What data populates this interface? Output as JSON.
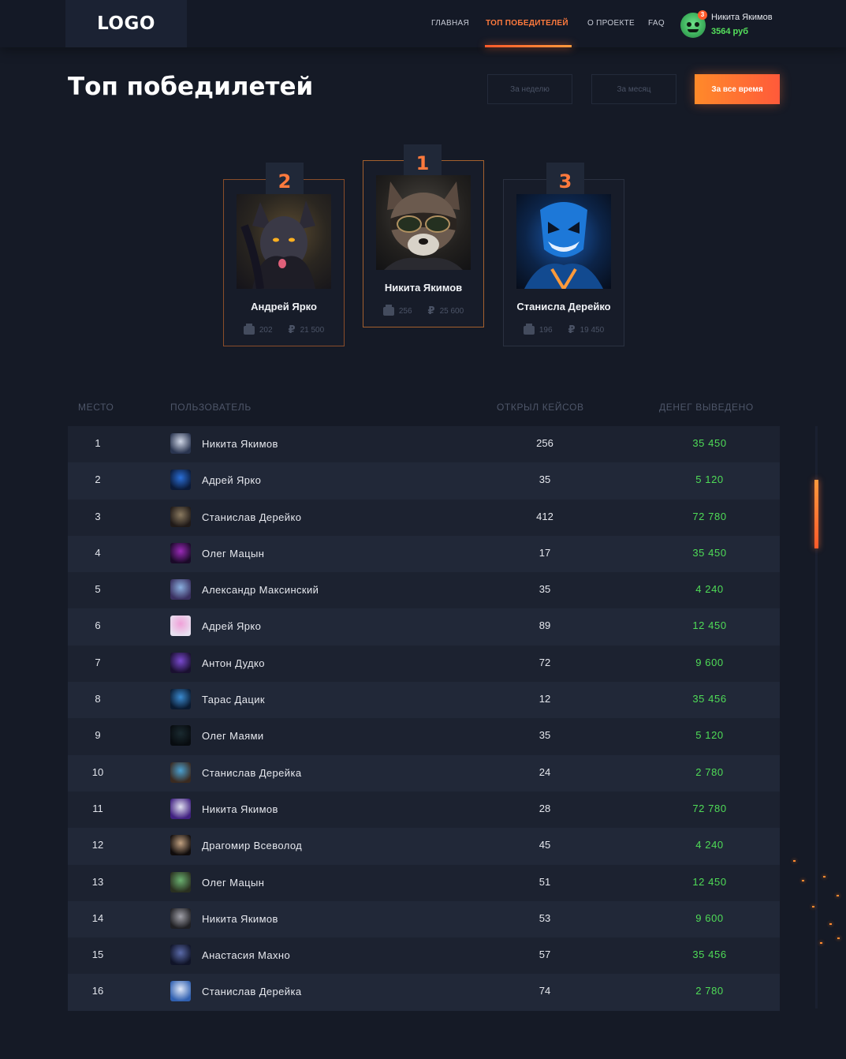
{
  "header": {
    "logo": "LOGO",
    "nav": [
      "ГЛАВНАЯ",
      "ТОП ПОБЕДИТЕЛЕЙ",
      "О ПРОЕКТЕ",
      "FAQ"
    ],
    "active_nav": "ТОП ПОБЕДИТЕЛЕЙ",
    "user": {
      "name": "Никита Якимов",
      "balance": "3564 руб",
      "notifications": "3"
    }
  },
  "page": {
    "title": "Топ победилетей",
    "filters": [
      "За неделю",
      "За месяц",
      "За все время"
    ],
    "active_filter": "За все время"
  },
  "podium": [
    {
      "rank": "2",
      "name": "Андрей Ярко",
      "cases": "202",
      "money": "21 500"
    },
    {
      "rank": "1",
      "name": "Никита Якимов",
      "cases": "256",
      "money": "25 600"
    },
    {
      "rank": "3",
      "name": "Станисла Дерейко",
      "cases": "196",
      "money": "19 450"
    }
  ],
  "table": {
    "headers": [
      "МЕСТО",
      "ПОЛЬЗОВАТЕЛЬ",
      "ОТКРЫЛ КЕЙСОВ",
      "ДЕНЕГ ВЫВЕДЕНО"
    ],
    "rows": [
      {
        "place": "1",
        "name": "Никита Якимов",
        "cases": "256",
        "money": "35 450"
      },
      {
        "place": "2",
        "name": "Адрей Ярко",
        "cases": "35",
        "money": "5 120"
      },
      {
        "place": "3",
        "name": "Станислав Дерейко",
        "cases": "412",
        "money": "72 780"
      },
      {
        "place": "4",
        "name": "Олег Мацын",
        "cases": "17",
        "money": "35 450"
      },
      {
        "place": "5",
        "name": "Александр Максинский",
        "cases": "35",
        "money": "4 240"
      },
      {
        "place": "6",
        "name": "Адрей Ярко",
        "cases": "89",
        "money": "12 450"
      },
      {
        "place": "7",
        "name": "Антон Дудко",
        "cases": "72",
        "money": "9 600"
      },
      {
        "place": "8",
        "name": "Тарас Дацик",
        "cases": "12",
        "money": "35 456"
      },
      {
        "place": "9",
        "name": "Олег Маями",
        "cases": "35",
        "money": "5 120"
      },
      {
        "place": "10",
        "name": "Станислав Дерейка",
        "cases": "24",
        "money": "2 780"
      },
      {
        "place": "11",
        "name": "Никита Якимов",
        "cases": "28",
        "money": "72 780"
      },
      {
        "place": "12",
        "name": "Драгомир Всеволод",
        "cases": "45",
        "money": "4 240"
      },
      {
        "place": "13",
        "name": "Олег Мацын",
        "cases": "51",
        "money": "12 450"
      },
      {
        "place": "14",
        "name": "Никита Якимов",
        "cases": "53",
        "money": "9 600"
      },
      {
        "place": "15",
        "name": "Анастасия Махно",
        "cases": "57",
        "money": "35 456"
      },
      {
        "place": "16",
        "name": "Станислав Дерейка",
        "cases": "74",
        "money": "2 780"
      }
    ]
  },
  "colors": {
    "accent": "#ff7a3d",
    "money": "#4fdc57",
    "background": "#151a26"
  }
}
